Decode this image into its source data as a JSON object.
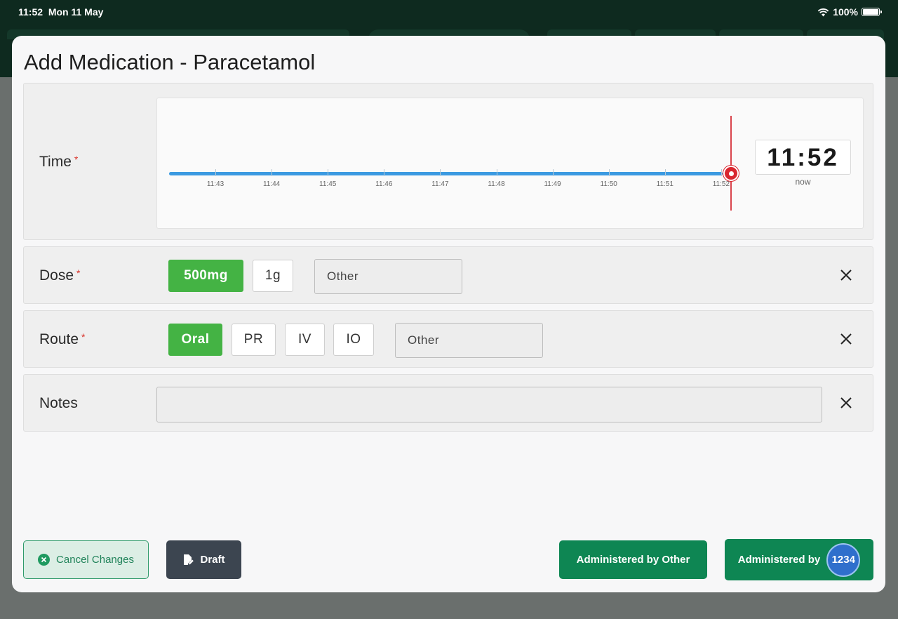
{
  "status_bar": {
    "time": "11:52",
    "date": "Mon 11 May",
    "battery": "100%"
  },
  "modal": {
    "title": "Add Medication - Paracetamol"
  },
  "time_row": {
    "label": "Time",
    "required_mark": "*",
    "ticks": [
      "11:43",
      "11:44",
      "11:45",
      "11:46",
      "11:47",
      "11:48",
      "11:49",
      "11:50",
      "11:51",
      "11:52"
    ],
    "selected_time": "11:52",
    "selected_caption": "now"
  },
  "dose_row": {
    "label": "Dose",
    "required_mark": "*",
    "options": [
      "500mg",
      "1g"
    ],
    "selected": "500mg",
    "other_placeholder": "Other"
  },
  "route_row": {
    "label": "Route",
    "required_mark": "*",
    "options": [
      "Oral",
      "PR",
      "IV",
      "IO"
    ],
    "selected": "Oral",
    "other_placeholder": "Other"
  },
  "notes_row": {
    "label": "Notes",
    "value": ""
  },
  "footer": {
    "cancel_label": "Cancel Changes",
    "draft_label": "Draft",
    "administered_other_label": "Administered by Other",
    "administered_by_label": "Administered by",
    "user_id": "1234"
  },
  "colors": {
    "accent_green": "#0e8653",
    "selected_option": "#44b344",
    "timeline": "#3b9ae1",
    "now_marker": "#d9262f"
  },
  "icons": {
    "cancel": "circle-x-icon",
    "draft": "edit-document-icon",
    "clear": "close-icon",
    "wifi": "wifi-icon",
    "battery": "battery-icon"
  }
}
